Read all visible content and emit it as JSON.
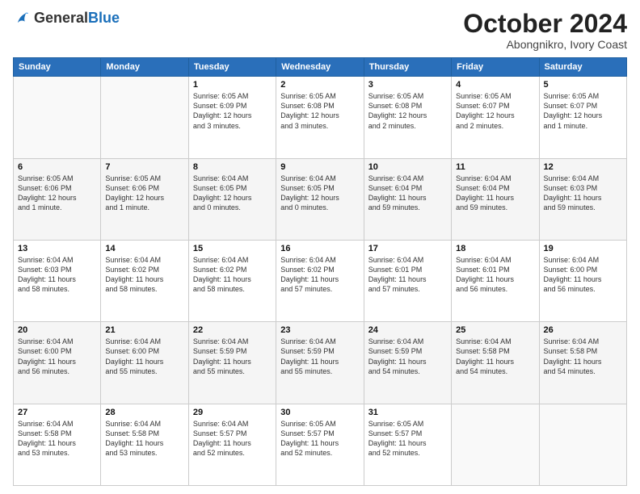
{
  "header": {
    "logo_general": "General",
    "logo_blue": "Blue",
    "month": "October 2024",
    "location": "Abongnikro, Ivory Coast"
  },
  "weekdays": [
    "Sunday",
    "Monday",
    "Tuesday",
    "Wednesday",
    "Thursday",
    "Friday",
    "Saturday"
  ],
  "weeks": [
    [
      {
        "day": "",
        "info": ""
      },
      {
        "day": "",
        "info": ""
      },
      {
        "day": "1",
        "info": "Sunrise: 6:05 AM\nSunset: 6:09 PM\nDaylight: 12 hours\nand 3 minutes."
      },
      {
        "day": "2",
        "info": "Sunrise: 6:05 AM\nSunset: 6:08 PM\nDaylight: 12 hours\nand 3 minutes."
      },
      {
        "day": "3",
        "info": "Sunrise: 6:05 AM\nSunset: 6:08 PM\nDaylight: 12 hours\nand 2 minutes."
      },
      {
        "day": "4",
        "info": "Sunrise: 6:05 AM\nSunset: 6:07 PM\nDaylight: 12 hours\nand 2 minutes."
      },
      {
        "day": "5",
        "info": "Sunrise: 6:05 AM\nSunset: 6:07 PM\nDaylight: 12 hours\nand 1 minute."
      }
    ],
    [
      {
        "day": "6",
        "info": "Sunrise: 6:05 AM\nSunset: 6:06 PM\nDaylight: 12 hours\nand 1 minute."
      },
      {
        "day": "7",
        "info": "Sunrise: 6:05 AM\nSunset: 6:06 PM\nDaylight: 12 hours\nand 1 minute."
      },
      {
        "day": "8",
        "info": "Sunrise: 6:04 AM\nSunset: 6:05 PM\nDaylight: 12 hours\nand 0 minutes."
      },
      {
        "day": "9",
        "info": "Sunrise: 6:04 AM\nSunset: 6:05 PM\nDaylight: 12 hours\nand 0 minutes."
      },
      {
        "day": "10",
        "info": "Sunrise: 6:04 AM\nSunset: 6:04 PM\nDaylight: 11 hours\nand 59 minutes."
      },
      {
        "day": "11",
        "info": "Sunrise: 6:04 AM\nSunset: 6:04 PM\nDaylight: 11 hours\nand 59 minutes."
      },
      {
        "day": "12",
        "info": "Sunrise: 6:04 AM\nSunset: 6:03 PM\nDaylight: 11 hours\nand 59 minutes."
      }
    ],
    [
      {
        "day": "13",
        "info": "Sunrise: 6:04 AM\nSunset: 6:03 PM\nDaylight: 11 hours\nand 58 minutes."
      },
      {
        "day": "14",
        "info": "Sunrise: 6:04 AM\nSunset: 6:02 PM\nDaylight: 11 hours\nand 58 minutes."
      },
      {
        "day": "15",
        "info": "Sunrise: 6:04 AM\nSunset: 6:02 PM\nDaylight: 11 hours\nand 58 minutes."
      },
      {
        "day": "16",
        "info": "Sunrise: 6:04 AM\nSunset: 6:02 PM\nDaylight: 11 hours\nand 57 minutes."
      },
      {
        "day": "17",
        "info": "Sunrise: 6:04 AM\nSunset: 6:01 PM\nDaylight: 11 hours\nand 57 minutes."
      },
      {
        "day": "18",
        "info": "Sunrise: 6:04 AM\nSunset: 6:01 PM\nDaylight: 11 hours\nand 56 minutes."
      },
      {
        "day": "19",
        "info": "Sunrise: 6:04 AM\nSunset: 6:00 PM\nDaylight: 11 hours\nand 56 minutes."
      }
    ],
    [
      {
        "day": "20",
        "info": "Sunrise: 6:04 AM\nSunset: 6:00 PM\nDaylight: 11 hours\nand 56 minutes."
      },
      {
        "day": "21",
        "info": "Sunrise: 6:04 AM\nSunset: 6:00 PM\nDaylight: 11 hours\nand 55 minutes."
      },
      {
        "day": "22",
        "info": "Sunrise: 6:04 AM\nSunset: 5:59 PM\nDaylight: 11 hours\nand 55 minutes."
      },
      {
        "day": "23",
        "info": "Sunrise: 6:04 AM\nSunset: 5:59 PM\nDaylight: 11 hours\nand 55 minutes."
      },
      {
        "day": "24",
        "info": "Sunrise: 6:04 AM\nSunset: 5:59 PM\nDaylight: 11 hours\nand 54 minutes."
      },
      {
        "day": "25",
        "info": "Sunrise: 6:04 AM\nSunset: 5:58 PM\nDaylight: 11 hours\nand 54 minutes."
      },
      {
        "day": "26",
        "info": "Sunrise: 6:04 AM\nSunset: 5:58 PM\nDaylight: 11 hours\nand 54 minutes."
      }
    ],
    [
      {
        "day": "27",
        "info": "Sunrise: 6:04 AM\nSunset: 5:58 PM\nDaylight: 11 hours\nand 53 minutes."
      },
      {
        "day": "28",
        "info": "Sunrise: 6:04 AM\nSunset: 5:58 PM\nDaylight: 11 hours\nand 53 minutes."
      },
      {
        "day": "29",
        "info": "Sunrise: 6:04 AM\nSunset: 5:57 PM\nDaylight: 11 hours\nand 52 minutes."
      },
      {
        "day": "30",
        "info": "Sunrise: 6:05 AM\nSunset: 5:57 PM\nDaylight: 11 hours\nand 52 minutes."
      },
      {
        "day": "31",
        "info": "Sunrise: 6:05 AM\nSunset: 5:57 PM\nDaylight: 11 hours\nand 52 minutes."
      },
      {
        "day": "",
        "info": ""
      },
      {
        "day": "",
        "info": ""
      }
    ]
  ]
}
